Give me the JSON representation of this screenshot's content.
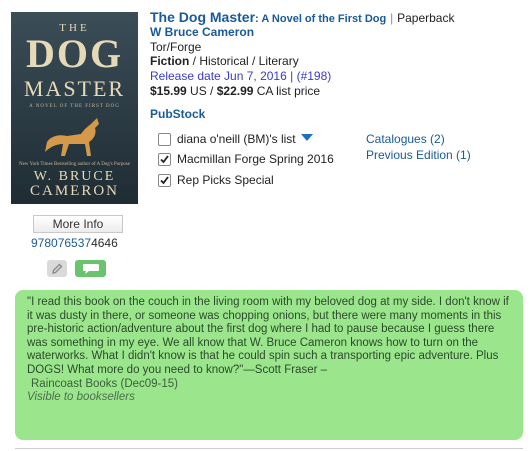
{
  "book": {
    "title": "The Dog Master",
    "subtitle": ": A Novel of the First Dog",
    "separator": "|",
    "format": "Paperback",
    "author": "W Bruce Cameron",
    "publisher": "Tor/Forge",
    "genre_main": "Fiction",
    "genre_rest": " / Historical / Literary",
    "release_label": "Release date Jun 7, 2016",
    "release_sep": " | (",
    "release_rank": "#198",
    "release_close": ")",
    "price_us": "$15.99",
    "price_us_label": " US / ",
    "price_ca": "$22.99",
    "price_ca_label": " CA list price"
  },
  "cover": {
    "the": "THE",
    "dog": "DOG",
    "master": "MASTER",
    "subtitle": "A NOVEL OF THE FIRST DOG",
    "quote": "New York Times Bestselling author of A Dog's Purpose",
    "author_first": "W. BRUCE",
    "author_last": "CAMERON"
  },
  "sidebar": {
    "more_info": "More Info",
    "isbn_hi": "978076537",
    "isbn_lo": "4646",
    "edit_icon": "pencil-icon",
    "comment_icon": "comment-icon",
    "comment_color": "#6ac46f"
  },
  "pubstock": {
    "label": "PubStock",
    "lists": [
      {
        "label": "diana o'neill (BM)'s list",
        "checked": false
      },
      {
        "label": "Macmillan Forge Spring 2016",
        "checked": true
      },
      {
        "label": "Rep Picks Special",
        "checked": true
      }
    ],
    "catalogues": "Catalogues (2)",
    "previous_edition": "Previous Edition (1)"
  },
  "review": {
    "text": "\"I read this book on the couch in the living room with my beloved dog at my side. I don't know if it was dusty in there, or someone was chopping onions, but there were many moments in this pre-historic action/adventure about the first dog where I had to pause because I guess there was something in my eye. We all know that W. Bruce Cameron knows how to turn on the waterworks. What I didn't know is that he could spin such a transporting epic adventure. Plus DOGS! What more do you need to know?\"—Scott Fraser –",
    "source": "Raincoast Books (Dec09-15)",
    "visibility": "Visible to booksellers",
    "bg_color": "#9be68c"
  }
}
